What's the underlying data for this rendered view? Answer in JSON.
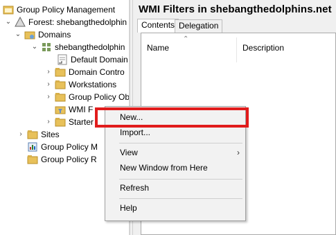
{
  "tree": {
    "root_label": "Group Policy Management",
    "forest_label": "Forest: shebangthedolphin",
    "domains_label": "Domains",
    "domain_label": "shebangthedolphin",
    "default_domain_label": "Default Domain",
    "domain_controllers_label": "Domain Contro",
    "workstations_label": "Workstations",
    "gpo_label": "Group Policy Ob",
    "wmi_label": "WMI F",
    "starter_label": "Starter",
    "sites_label": "Sites",
    "gp_modeling_label": "Group Policy M",
    "gp_results_label": "Group Policy R"
  },
  "right_pane": {
    "title": "WMI Filters in shebangthedolphins.net",
    "tabs": [
      "Contents",
      "Delegation"
    ],
    "columns": [
      "Name",
      "Description"
    ]
  },
  "context_menu": {
    "items": {
      "new": "New...",
      "import": "Import...",
      "view": "View",
      "new_window": "New Window from Here",
      "refresh": "Refresh",
      "help": "Help"
    },
    "submenu_arrow": "›"
  },
  "colors": {
    "highlight": "#e11c1c",
    "folder": "#e8c15a"
  }
}
